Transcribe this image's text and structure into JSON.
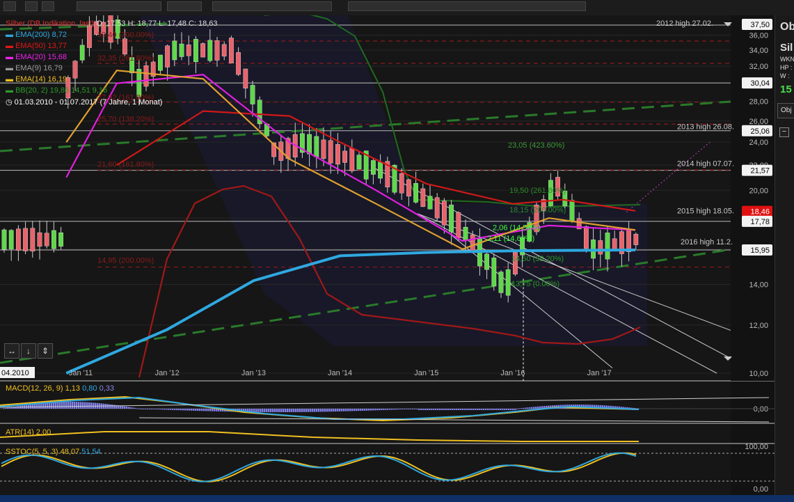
{
  "toolbar": {
    "side_panel_title": "Ob"
  },
  "side_panel": {
    "name": "Sil",
    "rows": [
      "WKN",
      "HP :",
      "W :"
    ],
    "price_short": "15",
    "button": "Obj",
    "collapse": "−"
  },
  "legend": {
    "title": "Silber (DB Indikation, last)",
    "ohlc": "O: 17,53  H: 18,77  L: 17,48  C: 18,63",
    "period": "01.03.2010 - 01.07.2017  (7 Jahre, 1 Monat)",
    "indicators": [
      {
        "label": "EMA(200)",
        "value": "8,72",
        "color": "#2fa8e0"
      },
      {
        "label": "EMA(50)",
        "value": "13,77",
        "color": "#e01818"
      },
      {
        "label": "EMA(20)",
        "value": "15,68",
        "color": "#ee22ee"
      },
      {
        "label": "EMA(9)",
        "value": "16,79",
        "color": "#9a9a9a"
      },
      {
        "label": "EMA(14)",
        "value": "16,19",
        "color": "#f0c020"
      },
      {
        "label": "BB(20, 2)",
        "value": "19,86",
        "extra": "14,51  9,16",
        "color": "#2a9a2a"
      }
    ]
  },
  "price_axis": {
    "ticks": [
      "36,00",
      "34,00",
      "32,00",
      "30,00",
      "28,00",
      "26,00",
      "24,00",
      "22,00",
      "20,00",
      "18,00",
      "16,00",
      "14,00",
      "12,00",
      "10,00"
    ],
    "boxes": [
      "37,50",
      "30,04",
      "25,06",
      "21,57",
      "18,46",
      "17,78",
      "15,95"
    ]
  },
  "time_axis": {
    "labels": [
      "Jan '11",
      "Jan '12",
      "Jan '13",
      "Jan '14",
      "Jan '15",
      "Jan '16",
      "Jan '17"
    ],
    "start_label": "04.2010"
  },
  "annotations": {
    "highs": [
      "2012 high 27.02.",
      "2013 high 26.08.",
      "2014 high 07.07.",
      "2015 high 18.05.",
      "2016 high 11.2."
    ],
    "fib_red": [
      "39,40 (300.00%)",
      "32,35 (261.80%)",
      "27,92 (161.80%)",
      "25,70 (138.20%)",
      "21,60 (161.80%)",
      "14,95 (200.00%)"
    ],
    "fib_green": [
      "23,05 (423.60%)",
      "19,50 (261.80%)",
      "18,15 (200.00%)",
      "2,06 (14,50%)",
      "2,11 (14,60%)",
      "14,50 (38.20%)",
      "13,75 (0.00%)"
    ]
  },
  "indicators": {
    "macd": {
      "label": "MACD(12, 26, 9)",
      "values": [
        "1,13",
        "0,80",
        "0,33"
      ],
      "axis": [
        "0,00"
      ]
    },
    "atr": {
      "label": "ATR(14)",
      "value": "2,00"
    },
    "sstoc": {
      "label": "SSTOC(5, 5, 3)",
      "values": [
        "48,07",
        "51,54"
      ],
      "axis": [
        "100,00",
        "0,00"
      ]
    }
  },
  "chart_data": {
    "type": "line",
    "title": "Silber (DB Indikation, last)",
    "xlabel": "",
    "ylabel": "",
    "x_range": [
      "2010-03",
      "2017-07"
    ],
    "ylim": [
      10,
      37.5
    ],
    "y_scale": "log",
    "series": [
      {
        "name": "Silber",
        "type": "candlestick",
        "x": [
          "2010-11",
          "2011-03",
          "2011-04",
          "2011-09",
          "2012-02",
          "2012-10",
          "2013-04",
          "2013-08",
          "2014-07",
          "2015-05",
          "2015-12",
          "2016-02",
          "2016-07",
          "2016-12",
          "2017-06"
        ],
        "values": [
          29.0,
          37.5,
          42.0,
          30.0,
          34.0,
          34.0,
          23.0,
          24.0,
          21.5,
          17.8,
          13.75,
          15.9,
          20.5,
          16.0,
          16.6
        ]
      },
      {
        "name": "EMA(200)",
        "x": [
          "2010-11",
          "2012-01",
          "2013-01",
          "2014-01",
          "2015-01",
          "2016-01",
          "2017-06"
        ],
        "values": [
          10.0,
          11.8,
          14.2,
          15.6,
          15.8,
          15.9,
          15.95
        ]
      },
      {
        "name": "EMA(50)",
        "x": [
          "2011-06",
          "2012-06",
          "2013-06",
          "2014-01",
          "2015-01",
          "2016-01",
          "2016-08",
          "2017-06"
        ],
        "values": [
          22.0,
          27.0,
          26.5,
          24.0,
          20.5,
          19.0,
          19.3,
          18.5
        ]
      },
      {
        "name": "EMA(20)",
        "x": [
          "2010-11",
          "2011-06",
          "2012-06",
          "2013-06",
          "2014-06",
          "2015-06",
          "2016-06",
          "2017-06"
        ],
        "values": [
          21.0,
          30.0,
          31.0,
          24.0,
          20.0,
          16.5,
          17.5,
          17.2
        ]
      },
      {
        "name": "EMA(14)",
        "x": [
          "2010-11",
          "2011-06",
          "2012-06",
          "2013-06",
          "2014-06",
          "2015-06",
          "2016-06",
          "2017-06"
        ],
        "values": [
          24.0,
          31.5,
          30.5,
          22.5,
          19.0,
          16.0,
          18.0,
          17.2
        ]
      }
    ],
    "grid": true,
    "legend": "top-left"
  }
}
